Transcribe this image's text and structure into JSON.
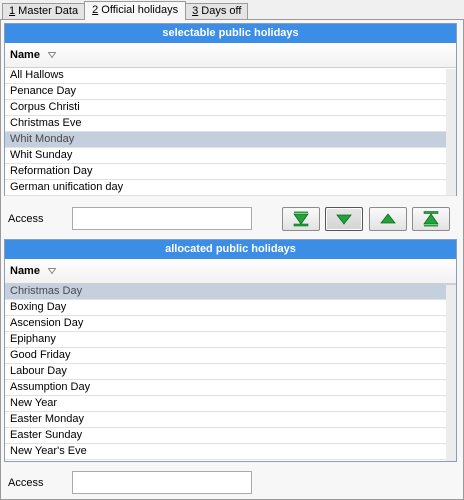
{
  "tabs": [
    {
      "number": "1",
      "label": " Master Data"
    },
    {
      "number": "2",
      "label": " Official holidays"
    },
    {
      "number": "3",
      "label": " Days off"
    }
  ],
  "selectable": {
    "title": "selectable public holidays",
    "column": "Name",
    "rows": [
      "All Hallows",
      "Penance Day",
      "Corpus Christi",
      "Christmas Eve",
      "Whit Monday",
      "Whit Sunday",
      "Reformation Day",
      "German unification day"
    ],
    "selected_index": 4
  },
  "access_label_1": "Access",
  "access_value_1": "",
  "buttons": [
    {
      "name": "move-bottom",
      "icon": "double-down-arrow"
    },
    {
      "name": "move-down",
      "icon": "down-arrow"
    },
    {
      "name": "move-up",
      "icon": "up-arrow"
    },
    {
      "name": "move-top",
      "icon": "double-up-arrow"
    }
  ],
  "allocated": {
    "title": "allocated public holidays",
    "column": "Name",
    "rows": [
      "Christmas Day",
      "Boxing Day",
      "Ascension Day",
      "Epiphany",
      "Good Friday",
      "Labour Day",
      "Assumption Day",
      "New Year",
      "Easter Monday",
      "Easter Sunday",
      "New Year's Eve"
    ],
    "selected_index": 0
  },
  "access_label_2": "Access",
  "access_value_2": "",
  "colors": {
    "header_blue": "#3b8de6",
    "arrow_green": "#1fa33a",
    "selection": "#c3cfdd"
  }
}
